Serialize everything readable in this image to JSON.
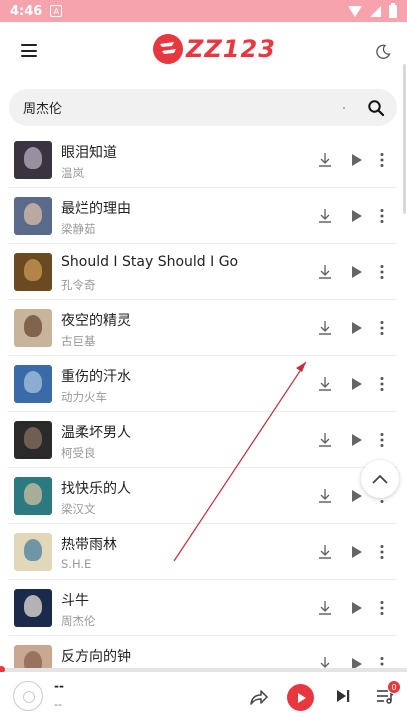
{
  "status_bar": {
    "time": "4:46",
    "notification_glyph": "A"
  },
  "header": {
    "logo_text": "ZZ123",
    "brand_color": "#e8373f"
  },
  "search": {
    "value": "周杰伦",
    "placeholder": ""
  },
  "songs": [
    {
      "title": "眼泪知道",
      "artist": "温岚",
      "cover_colors": [
        "#3a3340",
        "#b8b0c0"
      ]
    },
    {
      "title": "最烂的理由",
      "artist": "梁静茹",
      "cover_colors": [
        "#5a6a8a",
        "#d8c0a8"
      ]
    },
    {
      "title": "Should I Stay Should I Go",
      "artist": "孔令奇",
      "cover_colors": [
        "#6b4a22",
        "#c89a55"
      ]
    },
    {
      "title": "夜空的精灵",
      "artist": "古巨基",
      "cover_colors": [
        "#c8b49a",
        "#6a4a30"
      ]
    },
    {
      "title": "重伤的汗水",
      "artist": "动力火车",
      "cover_colors": [
        "#3a6aa8",
        "#a8c4e0"
      ]
    },
    {
      "title": "温柔坏男人",
      "artist": "柯受良",
      "cover_colors": [
        "#2a2a2a",
        "#8a7060"
      ]
    },
    {
      "title": "找快乐的人",
      "artist": "梁汉文",
      "cover_colors": [
        "#2a7a80",
        "#d0c0a0"
      ]
    },
    {
      "title": "热带雨林",
      "artist": "S.H.E",
      "cover_colors": [
        "#e0d8b8",
        "#4a80a0"
      ]
    },
    {
      "title": "斗牛",
      "artist": "周杰伦",
      "cover_colors": [
        "#1a2a4a",
        "#e8e0d8"
      ]
    },
    {
      "title": "反方向的钟",
      "artist": "",
      "cover_colors": [
        "#c8a890",
        "#8a6050"
      ]
    }
  ],
  "player": {
    "title": "--",
    "artist": "--",
    "queue_count": "0"
  }
}
